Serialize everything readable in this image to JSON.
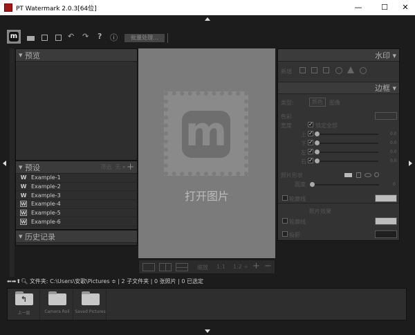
{
  "window": {
    "title": "PT Watermark 2.0.3[64位]",
    "minimize": "—",
    "maximize": "☐",
    "close": "✕"
  },
  "toolbar": {
    "batch_label": "批量处理...",
    "help": "?",
    "info": "ⓘ"
  },
  "left": {
    "preview_title": "预览",
    "presets_title": "预设",
    "filter_label": "筛选",
    "filter_value": "无 ▾",
    "add": "+",
    "presets": [
      {
        "label": "Example-1",
        "icon": "W"
      },
      {
        "label": "Example-2",
        "icon": "W"
      },
      {
        "label": "Example-3",
        "icon": "W"
      },
      {
        "label": "Example-4",
        "icon": "W"
      },
      {
        "label": "Example-5",
        "icon": "W"
      },
      {
        "label": "Example-6",
        "icon": "W"
      }
    ],
    "history_title": "历史记录"
  },
  "center": {
    "open_label": "打开图片",
    "zoom_label": "缩放",
    "zoom_1_1": "1:1",
    "zoom_1_2": "1:2 ÷",
    "zoom_in": "+",
    "zoom_out": "−"
  },
  "right": {
    "watermark_title": "水印 ▾",
    "add_label": "新增",
    "border_title": "边框 ▾",
    "type_label": "类型:",
    "type_color": "颜色",
    "type_image": "图像",
    "color_label": "色彩",
    "width_label": "宽度",
    "lock_all": "锁定全部",
    "sides": [
      {
        "label": "上",
        "value": "0.0"
      },
      {
        "label": "下",
        "value": "0.0"
      },
      {
        "label": "左",
        "value": "0.0"
      },
      {
        "label": "右",
        "value": "0.0"
      }
    ],
    "shape_label": "照片形状",
    "roundness_label": "圆度",
    "roundness_value": "0",
    "outline_label": "轮廓线",
    "effects_title": "照片效果",
    "effects_outline": "轮廓线",
    "shadow_label": "投影",
    "colors": {
      "border_color": "#1e1e1e",
      "outline": "#bdbdbd",
      "effects_outline": "#bdbdbd",
      "shadow": "#1e1e1e"
    }
  },
  "browser": {
    "folder_label": "文件夹:",
    "path": "C:\\Users\\安歌\\Pictures ≑",
    "stats": "| 2 子文件夹 | 0 张照片 | 0 已选定",
    "folders": [
      {
        "label": "上一层"
      },
      {
        "label": "Camera Roll"
      },
      {
        "label": "Saved Pictures"
      }
    ]
  }
}
